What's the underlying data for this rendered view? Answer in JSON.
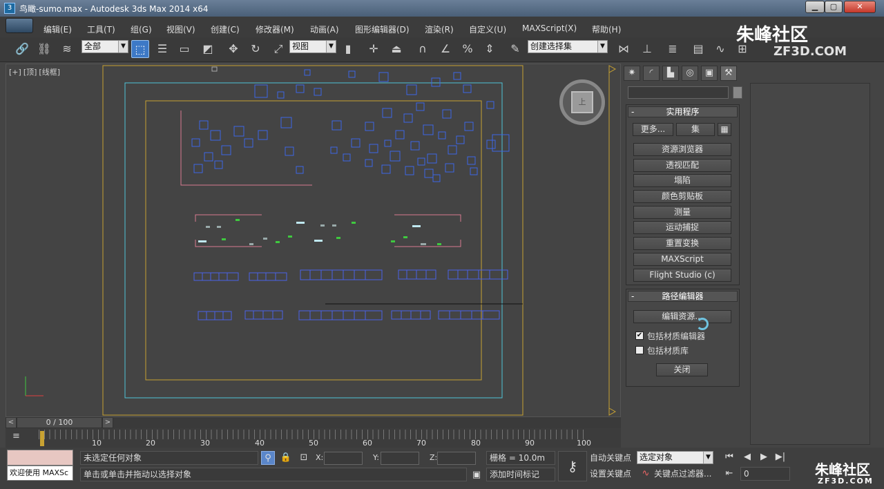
{
  "titlebar": {
    "title": "鸟瞰-sumo.max - Autodesk 3ds Max  2014 x64",
    "icon_label": "3",
    "min_label": "▁",
    "max_label": "▢",
    "close_label": "✕"
  },
  "menu": [
    "编辑(E)",
    "工具(T)",
    "组(G)",
    "视图(V)",
    "创建(C)",
    "修改器(M)",
    "动画(A)",
    "图形编辑器(D)",
    "渲染(R)",
    "自定义(U)",
    "MAXScript(X)",
    "帮助(H)"
  ],
  "toolbar": {
    "filter_value": "全部",
    "refcoord_value": "视图",
    "selection_set_value": "创建选择集",
    "combo_arrow": "▼"
  },
  "watermark": {
    "text": "朱峰社区",
    "url": "ZF3D.COM",
    "bottom_text": "朱峰社区",
    "bottom_url": "ZF3D.COM"
  },
  "viewport": {
    "label_plus": "[+]",
    "label_view": "[顶]",
    "label_shading": "[线框]",
    "viewcube_face": "上"
  },
  "command_panel": {
    "utilities_title": "实用程序",
    "more_label": "更多...",
    "sets_label": "集",
    "buttons": [
      "资源浏览器",
      "透视匹配",
      "塌陷",
      "颜色剪贴板",
      "测量",
      "运动捕捉",
      "重置变换",
      "MAXScript",
      "Flight Studio (c)"
    ],
    "path_title": "路径编辑器",
    "edit_resources_label": "编辑资源...",
    "include_material_editor": "包括材质编辑器",
    "include_material_library": "包括材质库",
    "close_label": "关闭",
    "checkbox_mark": "✔"
  },
  "timeline": {
    "position": "0 / 100",
    "current_frame": 0,
    "ticks": [
      "10",
      "20",
      "30",
      "40",
      "50",
      "60",
      "70",
      "80",
      "90",
      "100"
    ]
  },
  "status": {
    "listener_text": "欢迎使用 MAXSc",
    "selection_status": "未选定任何对象",
    "prompt": "单击或单击并拖动以选择对象",
    "x_label": "X:",
    "y_label": "Y:",
    "z_label": "Z:",
    "grid": "栅格 = 10.0m",
    "add_time_tag": "添加时间标记",
    "auto_key": "自动关键点",
    "set_key": "设置关键点",
    "selected_dropdown": "选定对象",
    "key_filters": "关键点过滤器...",
    "frame_field": "0"
  }
}
